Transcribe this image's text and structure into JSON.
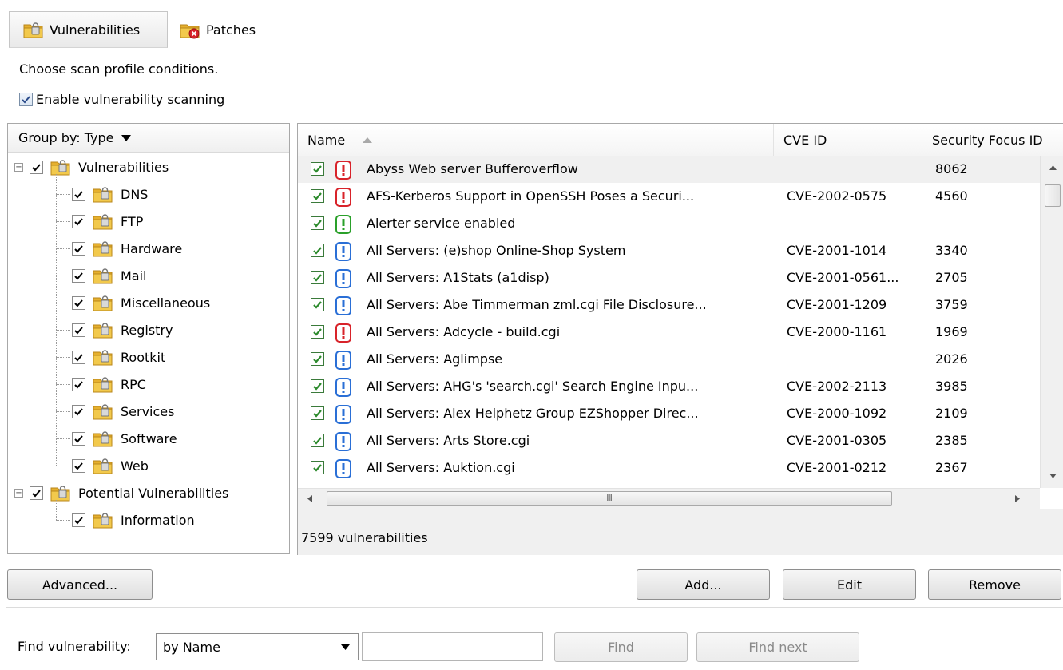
{
  "tabs": [
    {
      "label": "Vulnerabilities",
      "active": true
    },
    {
      "label": "Patches",
      "active": false
    }
  ],
  "prompt": "Choose scan profile conditions.",
  "enable_scanning": {
    "label": "Enable vulnerability scanning",
    "checked": true
  },
  "tree": {
    "group_by": "Group by: Type",
    "nodes": [
      {
        "label": "Vulnerabilities",
        "checked": true,
        "children": [
          "DNS",
          "FTP",
          "Hardware",
          "Mail",
          "Miscellaneous",
          "Registry",
          "Rootkit",
          "RPC",
          "Services",
          "Software",
          "Web"
        ]
      },
      {
        "label": "Potential Vulnerabilities",
        "checked": true,
        "children": [
          "Information"
        ]
      }
    ],
    "icon": "folder-lock-icon"
  },
  "list": {
    "columns": [
      "Name",
      "CVE ID",
      "Security Focus ID"
    ],
    "sort_column": "Name",
    "sort_direction": "ascending",
    "rows": [
      {
        "name": "Abyss Web server Bufferoverflow",
        "cve": "",
        "sfid": "8062",
        "severity": "high"
      },
      {
        "name": "AFS-Kerberos Support in OpenSSH Poses a Securi...",
        "cve": "CVE-2002-0575",
        "sfid": "4560",
        "severity": "high"
      },
      {
        "name": "Alerter service enabled",
        "cve": "",
        "sfid": "",
        "severity": "low"
      },
      {
        "name": "All Servers: (e)shop Online-Shop System",
        "cve": "CVE-2001-1014",
        "sfid": "3340",
        "severity": "medium"
      },
      {
        "name": "All Servers: A1Stats (a1disp)",
        "cve": "CVE-2001-0561...",
        "sfid": "2705",
        "severity": "medium"
      },
      {
        "name": "All Servers: Abe Timmerman zml.cgi File Disclosure...",
        "cve": "CVE-2001-1209",
        "sfid": "3759",
        "severity": "medium"
      },
      {
        "name": "All Servers: Adcycle - build.cgi",
        "cve": "CVE-2000-1161",
        "sfid": "1969",
        "severity": "high"
      },
      {
        "name": "All Servers: Aglimpse",
        "cve": "",
        "sfid": "2026",
        "severity": "medium"
      },
      {
        "name": "All Servers: AHG's 'search.cgi' Search Engine Inpu...",
        "cve": "CVE-2002-2113",
        "sfid": "3985",
        "severity": "medium"
      },
      {
        "name": "All Servers: Alex Heiphetz Group EZShopper Direc...",
        "cve": "CVE-2000-1092",
        "sfid": "2109",
        "severity": "medium"
      },
      {
        "name": "All Servers: Arts Store.cgi",
        "cve": "CVE-2001-0305",
        "sfid": "2385",
        "severity": "medium"
      },
      {
        "name": "All Servers: Auktion.cgi",
        "cve": "CVE-2001-0212",
        "sfid": "2367",
        "severity": "medium"
      }
    ],
    "status": "7599 vulnerabilities"
  },
  "buttons": {
    "advanced": "Advanced...",
    "add": "Add...",
    "edit": "Edit",
    "remove": "Remove"
  },
  "find": {
    "label_pre": "Find ",
    "label_accel": "v",
    "label_post": "ulnerability:",
    "mode": "by Name",
    "query": "",
    "find": "Find",
    "find_next": "Find next"
  },
  "colors": {
    "high": "#d8232a",
    "medium": "#2a6fd6",
    "low": "#2aa02a",
    "check": "#2c8a2c",
    "folder": "#e6b02e"
  }
}
